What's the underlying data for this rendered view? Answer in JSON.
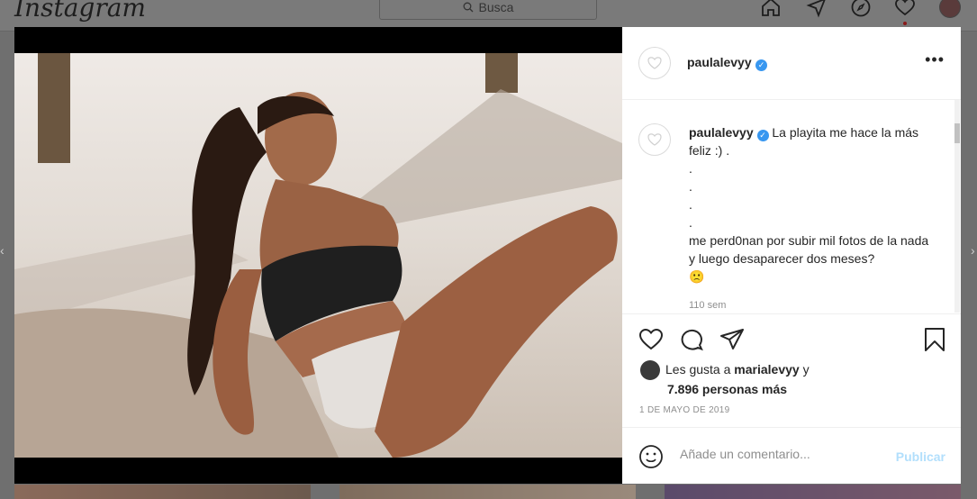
{
  "header": {
    "logo": "Instagram",
    "search_placeholder": "Busca",
    "icons": [
      "home-icon",
      "direct-icon",
      "explore-icon",
      "activity-icon",
      "profile-avatar"
    ]
  },
  "post": {
    "username": "paulalevyy",
    "verified": true,
    "caption_lines": [
      "La playita me hace la más feliz :) .",
      ".",
      ".",
      ".",
      ".",
      "me perd0nan por subir mil fotos de la nada y luego desaparecer dos meses?",
      "🙁"
    ],
    "caption_time": "110 sem",
    "likes_prefix": "Les gusta a",
    "liked_by": "marialevyy",
    "likes_and": "y",
    "likes_count": "7.896 personas más",
    "date": "1 DE MAYO DE 2019",
    "comment_placeholder": "Añade un comentario...",
    "publish_label": "Publicar"
  },
  "colors": {
    "verified": "#3897f0",
    "publish": "#b2dffc",
    "overlay": "#7a7a7a"
  }
}
